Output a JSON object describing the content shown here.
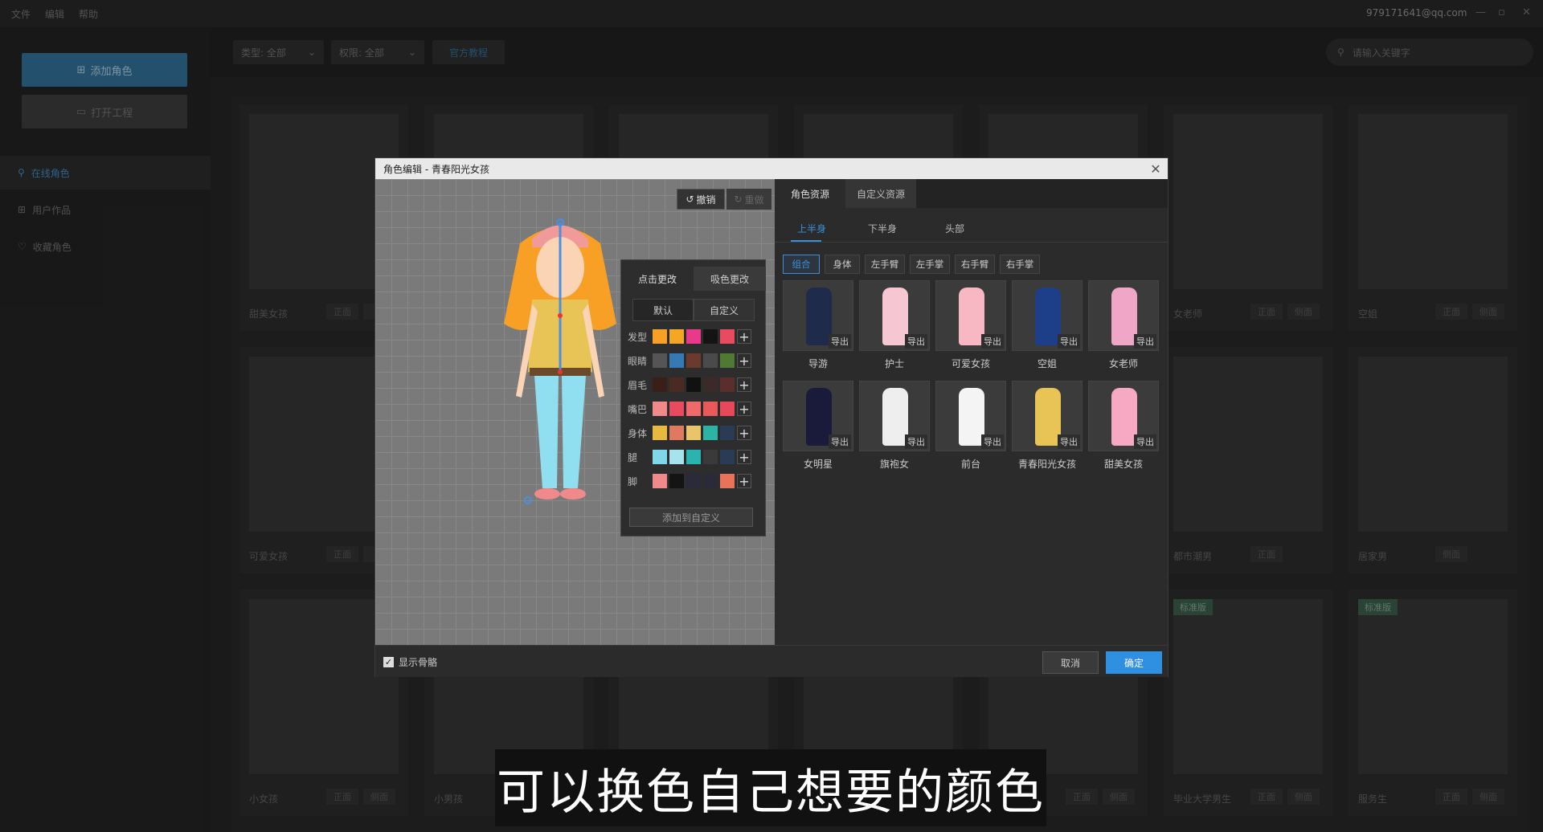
{
  "menu": [
    "文件",
    "编辑",
    "帮助"
  ],
  "account": "979171641@qq.com",
  "window_controls": [
    "—",
    "▫",
    "✕"
  ],
  "sidebar": {
    "add_role": "添加角色",
    "open_project": "打开工程",
    "nav": [
      {
        "label": "在线角色",
        "icon": "user-icon"
      },
      {
        "label": "用户作品",
        "icon": "grid-icon"
      },
      {
        "label": "收藏角色",
        "icon": "heart-icon"
      }
    ]
  },
  "filters": {
    "type": "类型:  全部",
    "permission": "权限:  全部",
    "tutorial": "官方教程",
    "search_placeholder": "请输入关键字"
  },
  "grid": {
    "cards": [
      {
        "name": "甜美女孩",
        "btns": [
          "正面",
          "侧"
        ]
      },
      {
        "name": "",
        "btns": []
      },
      {
        "name": "",
        "btns": []
      },
      {
        "name": "",
        "btns": []
      },
      {
        "name": "",
        "btns": []
      },
      {
        "name": "女老师",
        "btns": [
          "正面",
          "侧面"
        ]
      },
      {
        "name": "空姐",
        "btns": [
          "正面",
          "侧面"
        ]
      },
      {
        "name": "可爱女孩",
        "btns": [
          "正面",
          "侧"
        ]
      },
      {
        "name": "",
        "btns": []
      },
      {
        "name": "",
        "btns": []
      },
      {
        "name": "",
        "btns": []
      },
      {
        "name": "",
        "btns": []
      },
      {
        "name": "都市潮男",
        "btns": [
          "正面"
        ]
      },
      {
        "name": "居家男",
        "btns": [
          "侧面"
        ]
      },
      {
        "name": "小女孩",
        "btns": [
          "正面",
          "侧面"
        ]
      },
      {
        "name": "小男孩",
        "btns": []
      },
      {
        "name": "",
        "btns": []
      },
      {
        "name": "",
        "btns": []
      },
      {
        "name": "",
        "btns": [
          "正面",
          "侧面"
        ]
      },
      {
        "name": "毕业大学男生",
        "btns": [
          "正面",
          "侧面"
        ],
        "badge": "标准版"
      },
      {
        "name": "服务生",
        "btns": [
          "正面",
          "侧面"
        ],
        "badge": "标准版"
      }
    ]
  },
  "dialog": {
    "title": "角色编辑 - 青春阳光女孩",
    "undo": "撤销",
    "redo": "重做",
    "color_panel": {
      "tab_click": "点击更改",
      "tab_pick": "吸色更改",
      "sub_default": "默认",
      "sub_custom": "自定义",
      "rows": [
        {
          "label": "发型",
          "colors": [
            "#f7a025",
            "#f5a623",
            "#e8398a",
            "#141414",
            "#e84a5f"
          ]
        },
        {
          "label": "眼睛",
          "colors": [
            "#555555",
            "#3579b5",
            "#6b3a2e",
            "#4a4a4a",
            "#4f7a33"
          ]
        },
        {
          "label": "眉毛",
          "colors": [
            "#3a1e18",
            "#4a2a22",
            "#111111",
            "#3a2a28",
            "#5a2e2a"
          ]
        },
        {
          "label": "嘴巴",
          "colors": [
            "#f08a8a",
            "#e84a5f",
            "#ef6b6b",
            "#e8595a",
            "#e8495a"
          ]
        },
        {
          "label": "身体",
          "colors": [
            "#e8b940",
            "#e07a5f",
            "#e8c46a",
            "#2bb3a3",
            "#2a3b55"
          ]
        },
        {
          "label": "腿",
          "colors": [
            "#7fd7e8",
            "#a6e3ee",
            "#2bb3b0",
            "#3a3a3a",
            "#2a3b55"
          ]
        },
        {
          "label": "脚",
          "colors": [
            "#f08a8a",
            "#141414",
            "#2a2a3a",
            "#2a2a3a",
            "#e8735a"
          ]
        }
      ],
      "add_custom": "添加到自定义"
    },
    "right_tabs": [
      "角色资源",
      "自定义资源"
    ],
    "sub_tabs": [
      "上半身",
      "下半身",
      "头部"
    ],
    "pills": [
      "组合",
      "身体",
      "左手臂",
      "左手掌",
      "右手臂",
      "右手掌"
    ],
    "export_label": "导出",
    "items": [
      {
        "name": "导游",
        "color": "#1e2b4a"
      },
      {
        "name": "护士",
        "color": "#f6c6d3"
      },
      {
        "name": "可爱女孩",
        "color": "#f7b8c3"
      },
      {
        "name": "空姐",
        "color": "#1d3f8a"
      },
      {
        "name": "女老师",
        "color": "#f0a6c6"
      },
      {
        "name": "女明星",
        "color": "#1a1a3a"
      },
      {
        "name": "旗袍女",
        "color": "#eeeeee"
      },
      {
        "name": "前台",
        "color": "#f4f4f4"
      },
      {
        "name": "青春阳光女孩",
        "color": "#e8c456"
      },
      {
        "name": "甜美女孩",
        "color": "#f7a8c3"
      }
    ],
    "show_bones": "显示骨骼",
    "cancel": "取消",
    "ok": "确定"
  },
  "subtitle": "可以换色自己想要的颜色",
  "colors": {
    "accent": "#2f8fe0",
    "sidebar_active": "#3b86bb"
  }
}
